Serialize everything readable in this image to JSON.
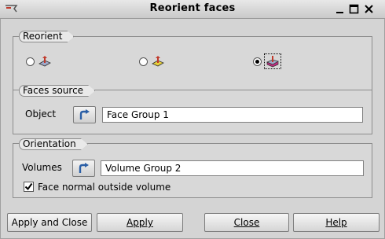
{
  "window": {
    "title": "Reorient faces"
  },
  "reorient": {
    "label": "Reorient",
    "options": [
      {
        "icon": "reorient-by-vector-icon",
        "checked": false
      },
      {
        "icon": "reorient-by-point-icon",
        "checked": false
      },
      {
        "icon": "reorient-by-volume-icon",
        "checked": true
      }
    ]
  },
  "faces_source": {
    "label": "Faces source",
    "object_label": "Object",
    "object_value": "Face Group 1"
  },
  "orientation": {
    "label": "Orientation",
    "volumes_label": "Volumes",
    "volumes_value": "Volume Group 2",
    "outside_label": "Face normal outside volume",
    "outside_checked": true
  },
  "buttons": {
    "apply_and_close": "Apply and Close",
    "apply": "Apply",
    "close": "Close",
    "help": "Help"
  }
}
